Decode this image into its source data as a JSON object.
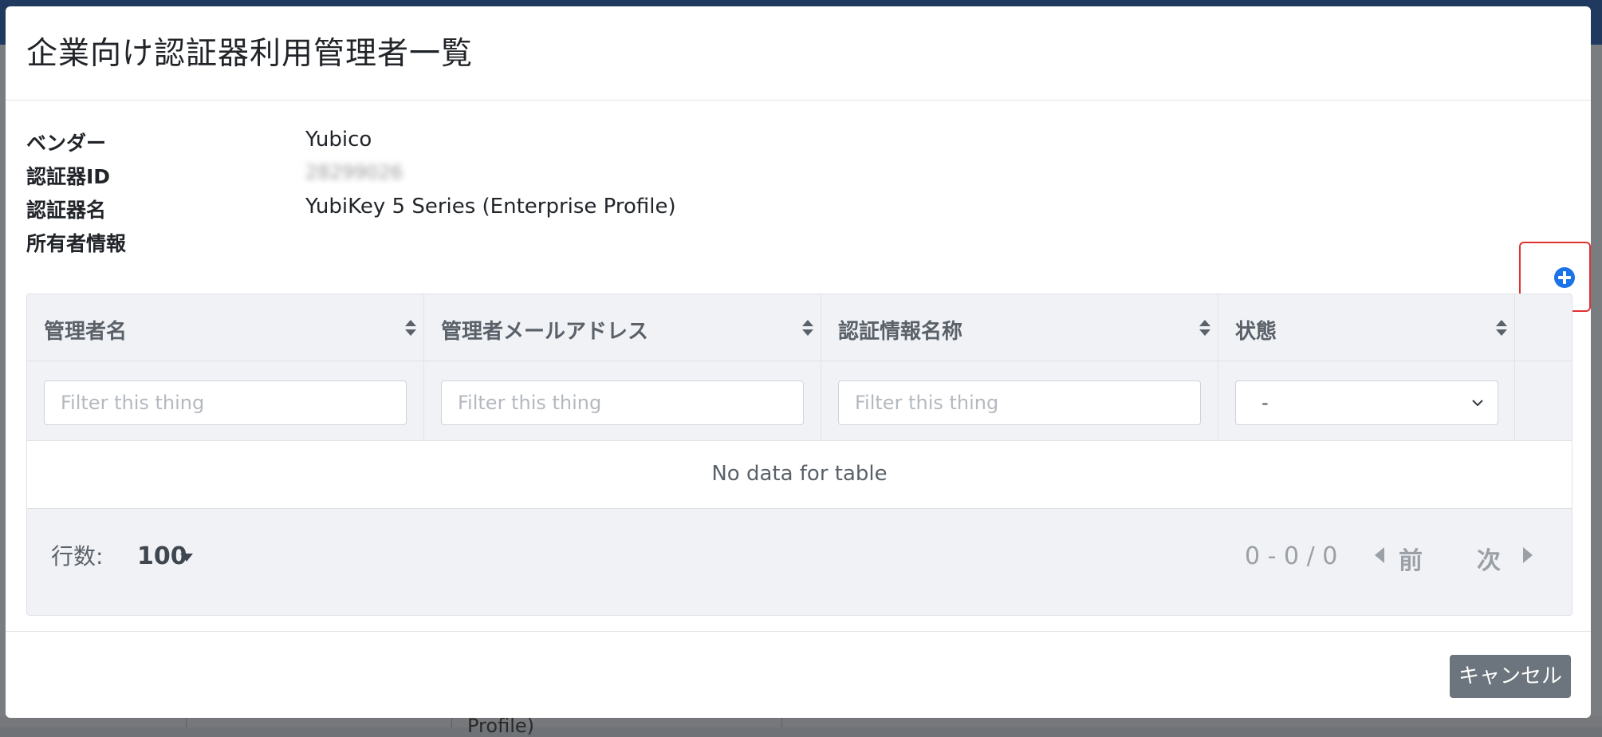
{
  "modal": {
    "title": "企業向け認証器利用管理者一覧",
    "info": [
      {
        "label": "ベンダー",
        "value": "Yubico"
      },
      {
        "label": "認証器ID",
        "value": "28299026"
      },
      {
        "label": "認証器名",
        "value": "YubiKey 5 Series (Enterprise Profile)"
      },
      {
        "label": "所有者情報",
        "value": ""
      }
    ],
    "add_icon": "plus-circle-icon",
    "cancel_label": "キャンセル"
  },
  "table": {
    "columns": [
      {
        "label": "管理者名",
        "filter_placeholder": "Filter this thing"
      },
      {
        "label": "管理者メールアドレス",
        "filter_placeholder": "Filter this thing"
      },
      {
        "label": "認証情報名称",
        "filter_placeholder": "Filter this thing"
      },
      {
        "label": "状態",
        "filter_selected": "-"
      }
    ],
    "empty_message": "No data for table",
    "footer": {
      "rows_label": "行数:",
      "rows_value": "100",
      "range": "0 - 0 / 0",
      "prev_label": "前",
      "next_label": "次"
    }
  },
  "background": {
    "row_text": "Profile)"
  },
  "colors": {
    "accent": "#1a73e8",
    "highlight_box": "#e03131",
    "cancel_button": "#6c757d"
  }
}
